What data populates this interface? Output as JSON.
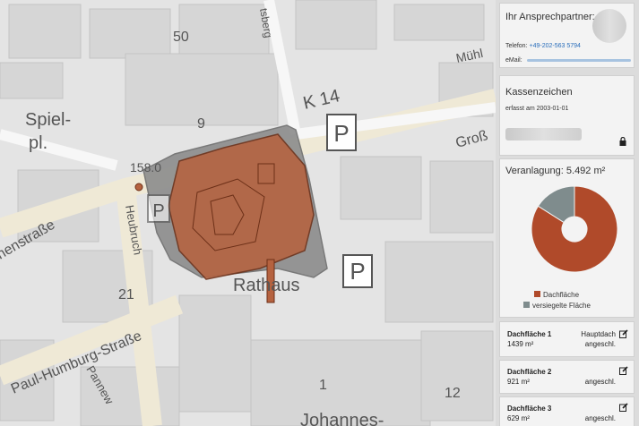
{
  "map": {
    "labels": {
      "street_k14": "K 14",
      "house_50": "50",
      "house_9": "9",
      "house_21": "21",
      "house_1": "1",
      "house_12": "12",
      "number_158": "158.0",
      "spielpl_1": "Spiel-",
      "spielpl_2": "pl.",
      "rathaus": "Rathaus",
      "paul_humburg": "Paul-Humburg-Straße",
      "heubruch": "Heubruch",
      "menstrasse": "nenstraße",
      "gross": "Groß",
      "muhl": "Mühl",
      "tsberg": "tsberg",
      "johannes": "Johannes-",
      "pannew": "Pannew",
      "parking_1": "P",
      "parking_2": "P",
      "parking_3": "P"
    },
    "colors": {
      "roof": "#b5623f",
      "sealed": "#8c8c8c"
    }
  },
  "contact": {
    "title": "Ihr Ansprechpartner:",
    "phone_label": "Telefon:",
    "phone": "+49-202-563 5794",
    "email_label": "eMail:"
  },
  "kassenzeichen": {
    "title": "Kassenzeichen",
    "date": "erfasst am 2003-01-01"
  },
  "veranlagung": {
    "title": "Veranlagung: 5.492 m²",
    "legend": [
      {
        "label": "Dachfläche",
        "color": "#b04a2a"
      },
      {
        "label": "versiegelte Fläche",
        "color": "#7f8c8d"
      }
    ]
  },
  "chart_data": {
    "type": "pie",
    "donut": true,
    "series": [
      {
        "name": "Dachfläche",
        "value": 84
      },
      {
        "name": "versiegelte Fläche",
        "value": 16
      }
    ]
  },
  "flaechen": [
    {
      "name": "Dachfläche 1",
      "area": "1439 m²",
      "type": "Hauptdach",
      "status": "angeschl."
    },
    {
      "name": "Dachfläche 2",
      "area": "921 m²",
      "type": "",
      "status": "angeschl."
    },
    {
      "name": "Dachfläche 3",
      "area": "629 m²",
      "type": "",
      "status": "angeschl."
    }
  ]
}
